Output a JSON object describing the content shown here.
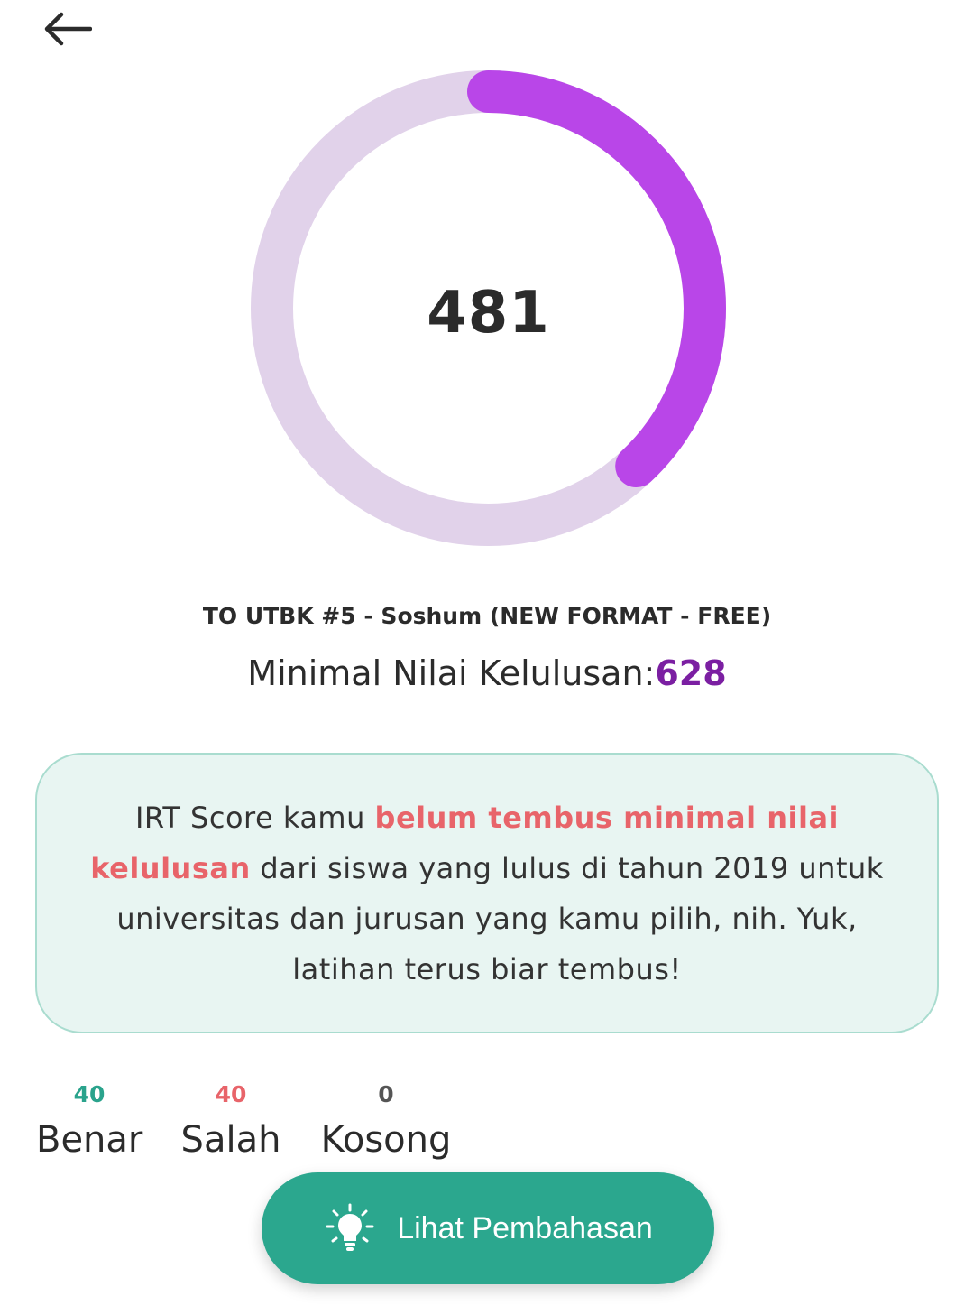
{
  "header": {
    "back_icon": "arrow-left-icon"
  },
  "score": {
    "value": "481",
    "progress_fraction": 0.38,
    "track_color": "#e1d2ea",
    "progress_color": "#b946e8"
  },
  "exam": {
    "title": "TO UTBK #5 - Soshum (NEW FORMAT - FREE)",
    "min_label": "Minimal Nilai Kelulusan:",
    "min_value": "628"
  },
  "message": {
    "part1": "IRT Score kamu ",
    "highlight": "belum tembus minimal nilai kelulusan",
    "part2": " dari siswa yang lulus di tahun 2019 untuk universitas dan jurusan yang kamu pilih, nih. Yuk, latihan terus biar tembus!"
  },
  "stats": {
    "benar": {
      "count": "40",
      "label": "Benar"
    },
    "salah": {
      "count": "40",
      "label": "Salah"
    },
    "kosong": {
      "count": "0",
      "label": "Kosong"
    }
  },
  "cta": {
    "icon": "lightbulb-icon",
    "label": "Lihat Pembahasan"
  },
  "colors": {
    "accent_green": "#2ba78e",
    "accent_red": "#e8646a",
    "accent_purple": "#7b1fa2"
  }
}
